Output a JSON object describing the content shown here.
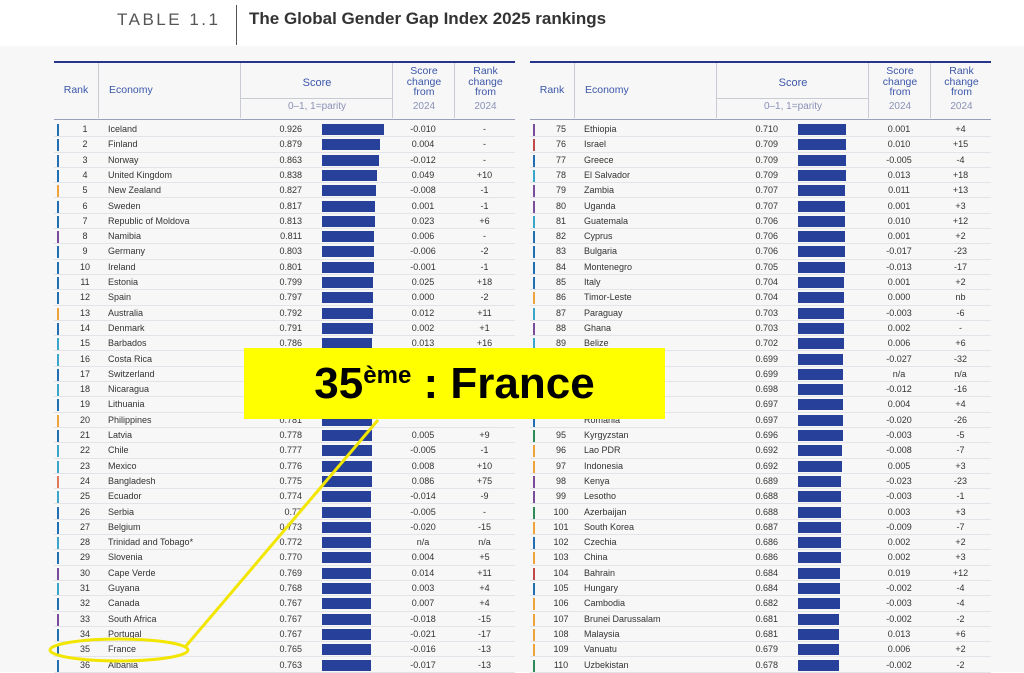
{
  "header": {
    "table_label": "TABLE 1.1",
    "title": "The Global Gender Gap Index 2025 rankings"
  },
  "columns": {
    "rank": "Rank",
    "economy": "Economy",
    "score": "Score",
    "score_scale": "0–1, 1=parity",
    "score_change": [
      "Score",
      "change",
      "from"
    ],
    "rank_change": [
      "Rank",
      "change",
      "from"
    ],
    "year": "2024"
  },
  "callout": {
    "rank": "35",
    "suffix": "ème",
    "label": " : France"
  },
  "colors": {
    "bar": "#27419b",
    "header_text": "#3b57a8",
    "callout_bg": "#ffff00",
    "highlight": "#f2e600"
  },
  "left_rows": [
    {
      "rank": "1",
      "economy": "Iceland",
      "score": "0.926",
      "change": "-0.010",
      "rank_change": "-",
      "marker": "#1f6fb2"
    },
    {
      "rank": "2",
      "economy": "Finland",
      "score": "0.879",
      "change": "0.004",
      "rank_change": "-",
      "marker": "#1f6fb2"
    },
    {
      "rank": "3",
      "economy": "Norway",
      "score": "0.863",
      "change": "-0.012",
      "rank_change": "-",
      "marker": "#1f6fb2"
    },
    {
      "rank": "4",
      "economy": "United Kingdom",
      "score": "0.838",
      "change": "0.049",
      "rank_change": "+10",
      "marker": "#1f6fb2"
    },
    {
      "rank": "5",
      "economy": "New Zealand",
      "score": "0.827",
      "change": "-0.008",
      "rank_change": "-1",
      "marker": "#f0a23b"
    },
    {
      "rank": "6",
      "economy": "Sweden",
      "score": "0.817",
      "change": "0.001",
      "rank_change": "-1",
      "marker": "#1f6fb2"
    },
    {
      "rank": "7",
      "economy": "Republic of Moldova",
      "score": "0.813",
      "change": "0.023",
      "rank_change": "+6",
      "marker": "#1f6fb2"
    },
    {
      "rank": "8",
      "economy": "Namibia",
      "score": "0.811",
      "change": "0.006",
      "rank_change": "-",
      "marker": "#7a4d9a"
    },
    {
      "rank": "9",
      "economy": "Germany",
      "score": "0.803",
      "change": "-0.006",
      "rank_change": "-2",
      "marker": "#1f6fb2"
    },
    {
      "rank": "10",
      "economy": "Ireland",
      "score": "0.801",
      "change": "-0.001",
      "rank_change": "-1",
      "marker": "#1f6fb2"
    },
    {
      "rank": "11",
      "economy": "Estonia",
      "score": "0.799",
      "change": "0.025",
      "rank_change": "+18",
      "marker": "#1f6fb2"
    },
    {
      "rank": "12",
      "economy": "Spain",
      "score": "0.797",
      "change": "0.000",
      "rank_change": "-2",
      "marker": "#1f6fb2"
    },
    {
      "rank": "13",
      "economy": "Australia",
      "score": "0.792",
      "change": "0.012",
      "rank_change": "+11",
      "marker": "#f0a23b"
    },
    {
      "rank": "14",
      "economy": "Denmark",
      "score": "0.791",
      "change": "0.002",
      "rank_change": "+1",
      "marker": "#1f6fb2"
    },
    {
      "rank": "15",
      "economy": "Barbados",
      "score": "0.786",
      "change": "0.013",
      "rank_change": "+16",
      "marker": "#3aa6c9"
    },
    {
      "rank": "16",
      "economy": "Costa Rica",
      "score": "",
      "change": "",
      "rank_change": "",
      "marker": "#3aa6c9"
    },
    {
      "rank": "17",
      "economy": "Switzerland",
      "score": "",
      "change": "",
      "rank_change": "",
      "marker": "#1f6fb2"
    },
    {
      "rank": "18",
      "economy": "Nicaragua",
      "score": "",
      "change": "",
      "rank_change": "",
      "marker": "#3aa6c9"
    },
    {
      "rank": "19",
      "economy": "Lithuania",
      "score": "",
      "change": "",
      "rank_change": "",
      "marker": "#1f6fb2"
    },
    {
      "rank": "20",
      "economy": "Philippines",
      "score": "0.781",
      "change": "",
      "rank_change": "",
      "marker": "#f0a23b"
    },
    {
      "rank": "21",
      "economy": "Latvia",
      "score": "0.778",
      "change": "0.005",
      "rank_change": "+9",
      "marker": "#1f6fb2"
    },
    {
      "rank": "22",
      "economy": "Chile",
      "score": "0.777",
      "change": "-0.005",
      "rank_change": "-1",
      "marker": "#3aa6c9"
    },
    {
      "rank": "23",
      "economy": "Mexico",
      "score": "0.776",
      "change": "0.008",
      "rank_change": "+10",
      "marker": "#3aa6c9"
    },
    {
      "rank": "24",
      "economy": "Bangladesh",
      "score": "0.775",
      "change": "0.086",
      "rank_change": "+75",
      "marker": "#e0785a"
    },
    {
      "rank": "25",
      "economy": "Ecuador",
      "score": "0.774",
      "change": "-0.014",
      "rank_change": "-9",
      "marker": "#3aa6c9"
    },
    {
      "rank": "26",
      "economy": "Serbia",
      "score": "0.77",
      "change": "-0.005",
      "rank_change": "-",
      "marker": "#1f6fb2"
    },
    {
      "rank": "27",
      "economy": "Belgium",
      "score": "0.773",
      "change": "-0.020",
      "rank_change": "-15",
      "marker": "#1f6fb2"
    },
    {
      "rank": "28",
      "economy": "Trinidad and Tobago*",
      "score": "0.772",
      "change": "n/a",
      "rank_change": "n/a",
      "marker": "#3aa6c9"
    },
    {
      "rank": "29",
      "economy": "Slovenia",
      "score": "0.770",
      "change": "0.004",
      "rank_change": "+5",
      "marker": "#1f6fb2"
    },
    {
      "rank": "30",
      "economy": "Cape Verde",
      "score": "0.769",
      "change": "0.014",
      "rank_change": "+11",
      "marker": "#7a4d9a"
    },
    {
      "rank": "31",
      "economy": "Guyana",
      "score": "0.768",
      "change": "0.003",
      "rank_change": "+4",
      "marker": "#3aa6c9"
    },
    {
      "rank": "32",
      "economy": "Canada",
      "score": "0.767",
      "change": "0.007",
      "rank_change": "+4",
      "marker": "#1f6fb2"
    },
    {
      "rank": "33",
      "economy": "South Africa",
      "score": "0.767",
      "change": "-0.018",
      "rank_change": "-15",
      "marker": "#7a4d9a"
    },
    {
      "rank": "34",
      "economy": "Portugal",
      "score": "0.767",
      "change": "-0.021",
      "rank_change": "-17",
      "marker": "#1f6fb2"
    },
    {
      "rank": "35",
      "economy": "France",
      "score": "0.765",
      "change": "-0.016",
      "rank_change": "-13",
      "marker": "#1f6fb2"
    },
    {
      "rank": "36",
      "economy": "Albania",
      "score": "0.763",
      "change": "-0.017",
      "rank_change": "-13",
      "marker": "#1f6fb2"
    }
  ],
  "right_rows": [
    {
      "rank": "75",
      "economy": "Ethiopia",
      "score": "0.710",
      "change": "0.001",
      "rank_change": "+4",
      "marker": "#7a4d9a"
    },
    {
      "rank": "76",
      "economy": "Israel",
      "score": "0.709",
      "change": "0.010",
      "rank_change": "+15",
      "marker": "#c04a4a"
    },
    {
      "rank": "77",
      "economy": "Greece",
      "score": "0.709",
      "change": "-0.005",
      "rank_change": "-4",
      "marker": "#1f6fb2"
    },
    {
      "rank": "78",
      "economy": "El Salvador",
      "score": "0.709",
      "change": "0.013",
      "rank_change": "+18",
      "marker": "#3aa6c9"
    },
    {
      "rank": "79",
      "economy": "Zambia",
      "score": "0.707",
      "change": "0.011",
      "rank_change": "+13",
      "marker": "#7a4d9a"
    },
    {
      "rank": "80",
      "economy": "Uganda",
      "score": "0.707",
      "change": "0.001",
      "rank_change": "+3",
      "marker": "#7a4d9a"
    },
    {
      "rank": "81",
      "economy": "Guatemala",
      "score": "0.706",
      "change": "0.010",
      "rank_change": "+12",
      "marker": "#3aa6c9"
    },
    {
      "rank": "82",
      "economy": "Cyprus",
      "score": "0.706",
      "change": "0.001",
      "rank_change": "+2",
      "marker": "#1f6fb2"
    },
    {
      "rank": "83",
      "economy": "Bulgaria",
      "score": "0.706",
      "change": "-0.017",
      "rank_change": "-23",
      "marker": "#1f6fb2"
    },
    {
      "rank": "84",
      "economy": "Montenegro",
      "score": "0.705",
      "change": "-0.013",
      "rank_change": "-17",
      "marker": "#1f6fb2"
    },
    {
      "rank": "85",
      "economy": "Italy",
      "score": "0.704",
      "change": "0.001",
      "rank_change": "+2",
      "marker": "#1f6fb2"
    },
    {
      "rank": "86",
      "economy": "Timor-Leste",
      "score": "0.704",
      "change": "0.000",
      "rank_change": "nb",
      "marker": "#f0a23b"
    },
    {
      "rank": "87",
      "economy": "Paraguay",
      "score": "0.703",
      "change": "-0.003",
      "rank_change": "-6",
      "marker": "#3aa6c9"
    },
    {
      "rank": "88",
      "economy": "Ghana",
      "score": "0.703",
      "change": "0.002",
      "rank_change": "-",
      "marker": "#7a4d9a"
    },
    {
      "rank": "89",
      "economy": "Belize",
      "score": "0.702",
      "change": "0.006",
      "rank_change": "+6",
      "marker": "#3aa6c9"
    },
    {
      "rank": "",
      "economy": "",
      "score": "0.699",
      "change": "-0.027",
      "rank_change": "-32",
      "marker": ""
    },
    {
      "rank": "",
      "economy": "",
      "score": "0.699",
      "change": "n/a",
      "rank_change": "n/a",
      "marker": ""
    },
    {
      "rank": "",
      "economy": "",
      "score": "0.698",
      "change": "-0.012",
      "rank_change": "-16",
      "marker": ""
    },
    {
      "rank": "",
      "economy": "",
      "score": "0.697",
      "change": "0.004",
      "rank_change": "+4",
      "marker": ""
    },
    {
      "rank": "",
      "economy": "Romania",
      "score": "0.697",
      "change": "-0.020",
      "rank_change": "-26",
      "marker": "#1f6fb2"
    },
    {
      "rank": "95",
      "economy": "Kyrgyzstan",
      "score": "0.696",
      "change": "-0.003",
      "rank_change": "-5",
      "marker": "#2e8b57"
    },
    {
      "rank": "96",
      "economy": "Lao PDR",
      "score": "0.692",
      "change": "-0.008",
      "rank_change": "-7",
      "marker": "#f0a23b"
    },
    {
      "rank": "97",
      "economy": "Indonesia",
      "score": "0.692",
      "change": "0.005",
      "rank_change": "+3",
      "marker": "#f0a23b"
    },
    {
      "rank": "98",
      "economy": "Kenya",
      "score": "0.689",
      "change": "-0.023",
      "rank_change": "-23",
      "marker": "#7a4d9a"
    },
    {
      "rank": "99",
      "economy": "Lesotho",
      "score": "0.688",
      "change": "-0.003",
      "rank_change": "-1",
      "marker": "#7a4d9a"
    },
    {
      "rank": "100",
      "economy": "Azerbaijan",
      "score": "0.688",
      "change": "0.003",
      "rank_change": "+3",
      "marker": "#2e8b57"
    },
    {
      "rank": "101",
      "economy": "South Korea",
      "score": "0.687",
      "change": "-0.009",
      "rank_change": "-7",
      "marker": "#f0a23b"
    },
    {
      "rank": "102",
      "economy": "Czechia",
      "score": "0.686",
      "change": "0.002",
      "rank_change": "+2",
      "marker": "#1f6fb2"
    },
    {
      "rank": "103",
      "economy": "China",
      "score": "0.686",
      "change": "0.002",
      "rank_change": "+3",
      "marker": "#f0a23b"
    },
    {
      "rank": "104",
      "economy": "Bahrain",
      "score": "0.684",
      "change": "0.019",
      "rank_change": "+12",
      "marker": "#c04a4a"
    },
    {
      "rank": "105",
      "economy": "Hungary",
      "score": "0.684",
      "change": "-0.002",
      "rank_change": "-4",
      "marker": "#1f6fb2"
    },
    {
      "rank": "106",
      "economy": "Cambodia",
      "score": "0.682",
      "change": "-0.003",
      "rank_change": "-4",
      "marker": "#f0a23b"
    },
    {
      "rank": "107",
      "economy": "Brunei Darussalam",
      "score": "0.681",
      "change": "-0.002",
      "rank_change": "-2",
      "marker": "#f0a23b"
    },
    {
      "rank": "108",
      "economy": "Malaysia",
      "score": "0.681",
      "change": "0.013",
      "rank_change": "+6",
      "marker": "#f0a23b"
    },
    {
      "rank": "109",
      "economy": "Vanuatu",
      "score": "0.679",
      "change": "0.006",
      "rank_change": "+2",
      "marker": "#f0a23b"
    },
    {
      "rank": "110",
      "economy": "Uzbekistan",
      "score": "0.678",
      "change": "-0.002",
      "rank_change": "-2",
      "marker": "#2e8b57"
    }
  ]
}
